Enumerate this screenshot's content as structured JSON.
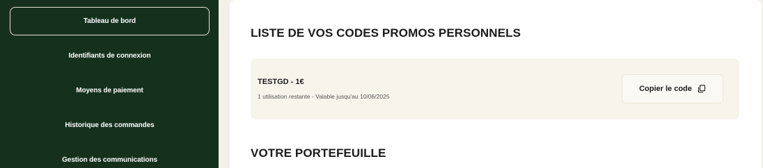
{
  "sidebar": {
    "items": [
      {
        "label": "Tableau de bord",
        "active": true
      },
      {
        "label": "Identifiants de connexion",
        "active": false
      },
      {
        "label": "Moyens de paiement",
        "active": false
      },
      {
        "label": "Historique des commandes",
        "active": false
      },
      {
        "label": "Gestion des communications",
        "active": false
      }
    ]
  },
  "main": {
    "promos_title": "LISTE DE VOS CODES PROMOS PERSONNELS",
    "promo": {
      "code": "TESTGD - 1€",
      "meta": "1 utilisation restante - Valable jusqu'au 10/06/2025",
      "copy_label": "Copier le code",
      "copy_icon": "copy-icon"
    },
    "wallet_title": "VOTRE PORTEFEUILLE"
  },
  "colors": {
    "sidebar_bg": "#15311d",
    "page_bg": "#f3f0e8",
    "card_bg": "#f7f4ec"
  }
}
